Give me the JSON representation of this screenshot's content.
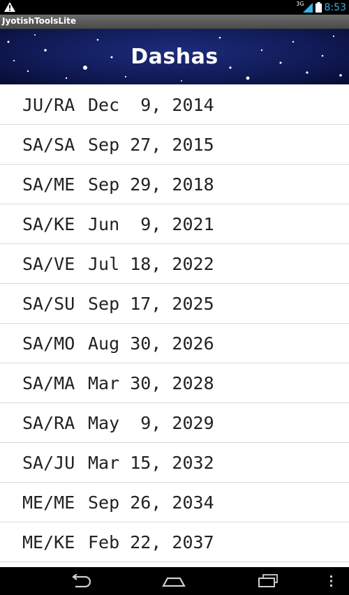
{
  "status_bar": {
    "network_label": "3G",
    "time": "8:53",
    "icons": [
      "warning-icon",
      "signal-icon",
      "battery-icon"
    ]
  },
  "app_title": "JyotishToolsLite",
  "header": {
    "title": "Dashas"
  },
  "dashas": [
    {
      "period": "JU/RA",
      "date": "Dec  9, 2014"
    },
    {
      "period": "SA/SA",
      "date": "Sep 27, 2015"
    },
    {
      "period": "SA/ME",
      "date": "Sep 29, 2018"
    },
    {
      "period": "SA/KE",
      "date": "Jun  9, 2021"
    },
    {
      "period": "SA/VE",
      "date": "Jul 18, 2022"
    },
    {
      "period": "SA/SU",
      "date": "Sep 17, 2025"
    },
    {
      "period": "SA/MO",
      "date": "Aug 30, 2026"
    },
    {
      "period": "SA/MA",
      "date": "Mar 30, 2028"
    },
    {
      "period": "SA/RA",
      "date": "May  9, 2029"
    },
    {
      "period": "SA/JU",
      "date": "Mar 15, 2032"
    },
    {
      "period": "ME/ME",
      "date": "Sep 26, 2034"
    },
    {
      "period": "ME/KE",
      "date": "Feb 22, 2037"
    }
  ],
  "nav_bar": {
    "icons": [
      "back-icon",
      "home-icon",
      "recent-apps-icon",
      "menu-icon"
    ]
  },
  "colors": {
    "clock": "#33b5e5",
    "header_bg": "#101a55",
    "divider": "#d9d9d9"
  }
}
